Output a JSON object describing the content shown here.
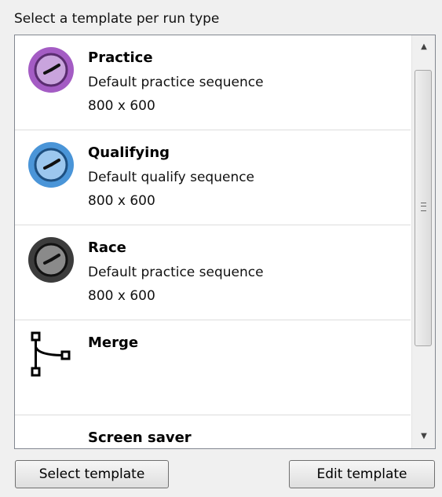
{
  "header": {
    "title": "Select a template per run type"
  },
  "list": {
    "items": [
      {
        "title": "Practice",
        "line1": "Default practice sequence",
        "line2": "800 x 600",
        "icon": "clock-icon",
        "color": "#a45cc4"
      },
      {
        "title": "Qualifying",
        "line1": "Default qualify sequence",
        "line2": "800 x 600",
        "icon": "clock-icon",
        "color": "#4a95d8"
      },
      {
        "title": "Race",
        "line1": "Default practice sequence",
        "line2": "800 x 600",
        "icon": "clock-icon",
        "color": "#3c3c3c"
      },
      {
        "title": "Merge",
        "line1": "",
        "line2": "",
        "icon": "merge-icon",
        "color": "#000000"
      },
      {
        "title": "Screen saver",
        "line1": "",
        "line2": "",
        "icon": "",
        "color": ""
      }
    ]
  },
  "scrollbar": {
    "up": "▲",
    "down": "▼"
  },
  "buttons": {
    "select": "Select template",
    "edit": "Edit template"
  }
}
